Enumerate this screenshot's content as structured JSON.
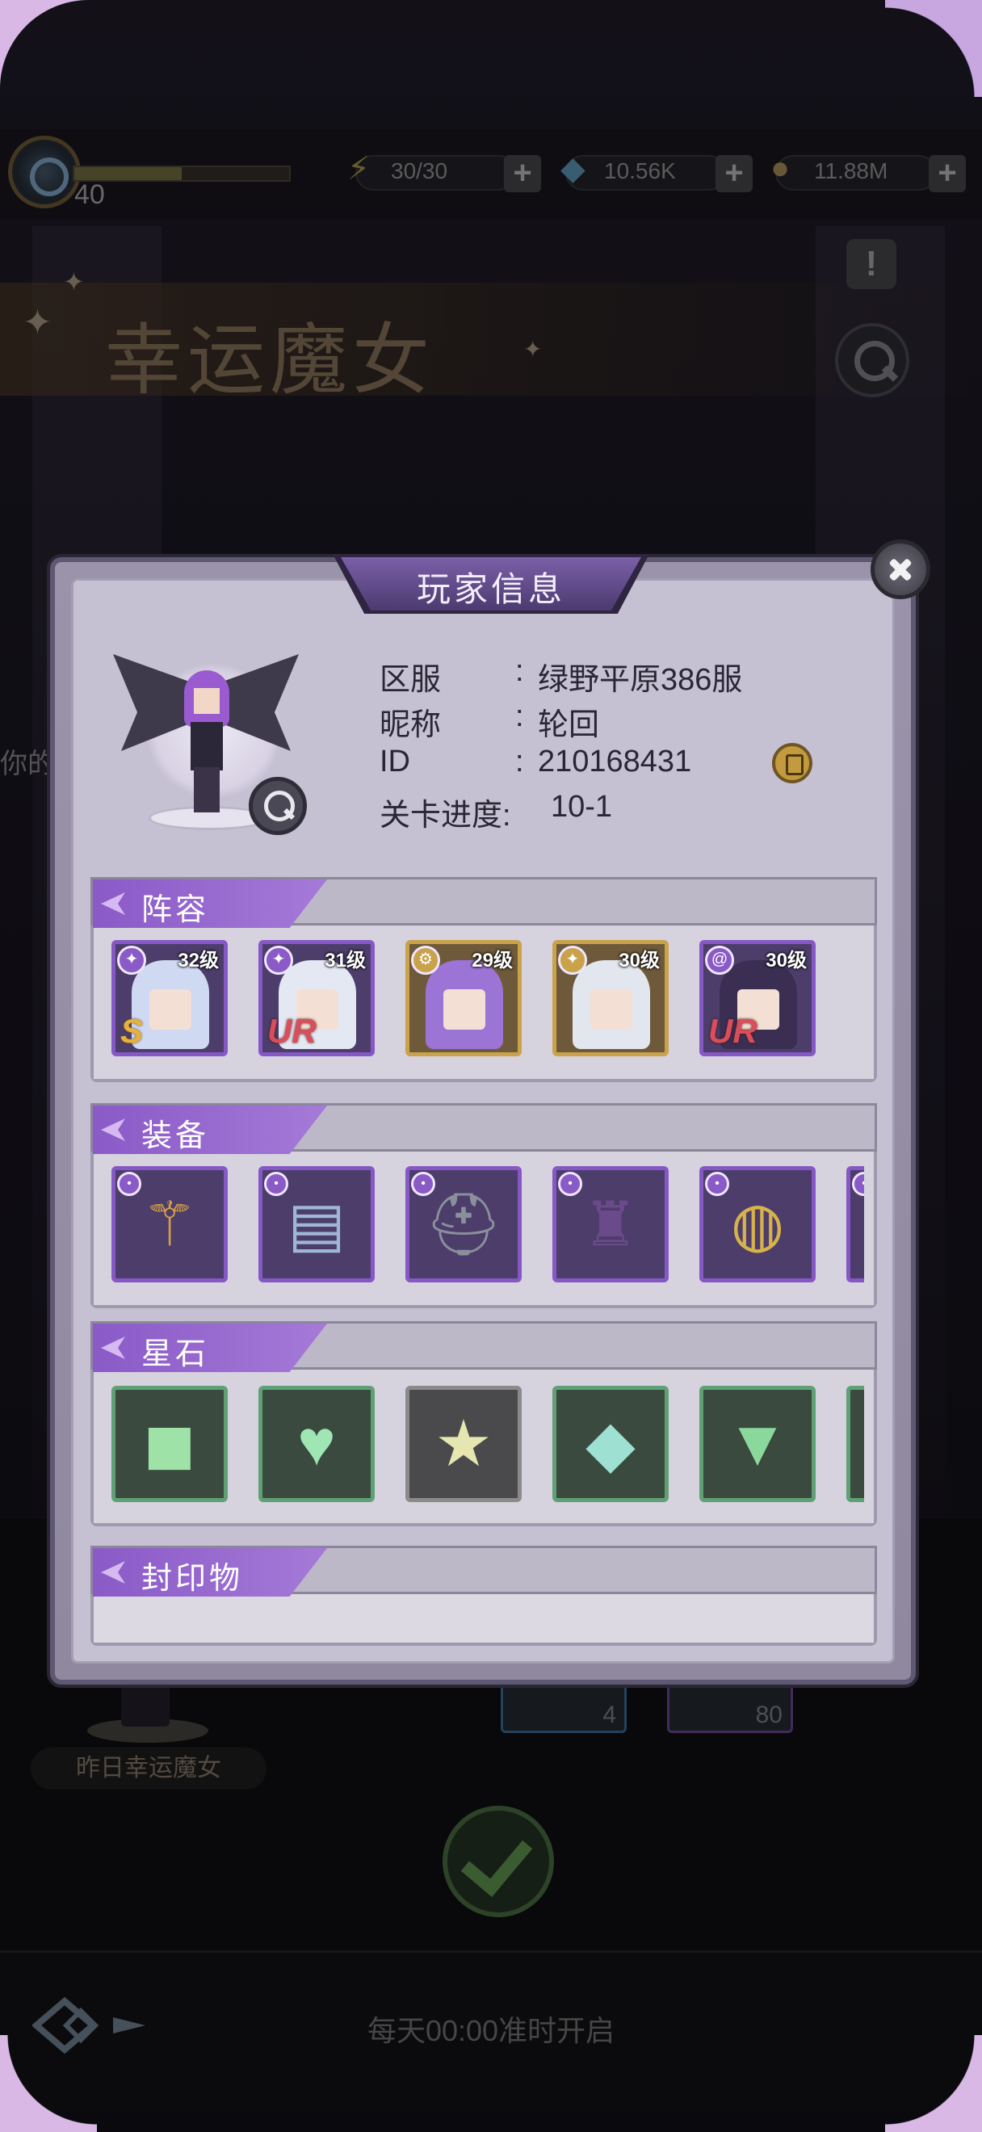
{
  "background": {
    "event_title": "幸运魔女",
    "level": "40",
    "xp_fraction": 0.5,
    "energy": "30/30",
    "gems": "10.56K",
    "gold": "11.88M",
    "side_text": "你的",
    "yesterday_label": "昨日幸运魔女",
    "item_counts": [
      "4",
      "80"
    ],
    "bottom_note": "每天00:00准时开启"
  },
  "modal": {
    "title": "玩家信息",
    "info": {
      "server_label": "区服",
      "server_value": "绿野平原386服",
      "nickname_label": "昵称",
      "nickname_value": "轮回",
      "id_label": "ID",
      "id_value": "210168431",
      "progress_label": "关卡进度:",
      "progress_value": "10-1"
    },
    "colon": ":",
    "lineup": {
      "title": "阵容",
      "heroes": [
        {
          "level": "32级",
          "rarity": "S",
          "frame": "purple",
          "hair": "#cfd9f2",
          "class_icon": "wand-icon"
        },
        {
          "level": "31级",
          "rarity": "UR",
          "frame": "purple",
          "hair": "#e4e8f2",
          "class_icon": "wand-icon"
        },
        {
          "level": "29级",
          "rarity": "",
          "frame": "gold",
          "hair": "#9b74d6",
          "class_icon": "gear-icon"
        },
        {
          "level": "30级",
          "rarity": "",
          "frame": "gold",
          "hair": "#e2e6ee",
          "class_icon": "wand-icon"
        },
        {
          "level": "30级",
          "rarity": "UR",
          "frame": "purple",
          "hair": "#3a2f52",
          "class_icon": "swirl-icon"
        }
      ]
    },
    "equipment": {
      "title": "装备",
      "items": [
        "scepter-icon",
        "spellbook-icon",
        "helmet-icon",
        "cloak-icon",
        "ring-icon",
        "partial-item-icon"
      ]
    },
    "starstones": {
      "title": "星石",
      "gems": [
        {
          "shape": "square-gem-icon",
          "frame": "green"
        },
        {
          "shape": "heart-gem-icon",
          "frame": "green"
        },
        {
          "shape": "star-gem-icon",
          "frame": "gray"
        },
        {
          "shape": "diamond-gem-icon",
          "frame": "green"
        },
        {
          "shape": "trillion-gem-icon",
          "frame": "green"
        },
        {
          "shape": "partial-gem-icon",
          "frame": "green"
        }
      ]
    },
    "seals": {
      "title": "封印物"
    }
  }
}
